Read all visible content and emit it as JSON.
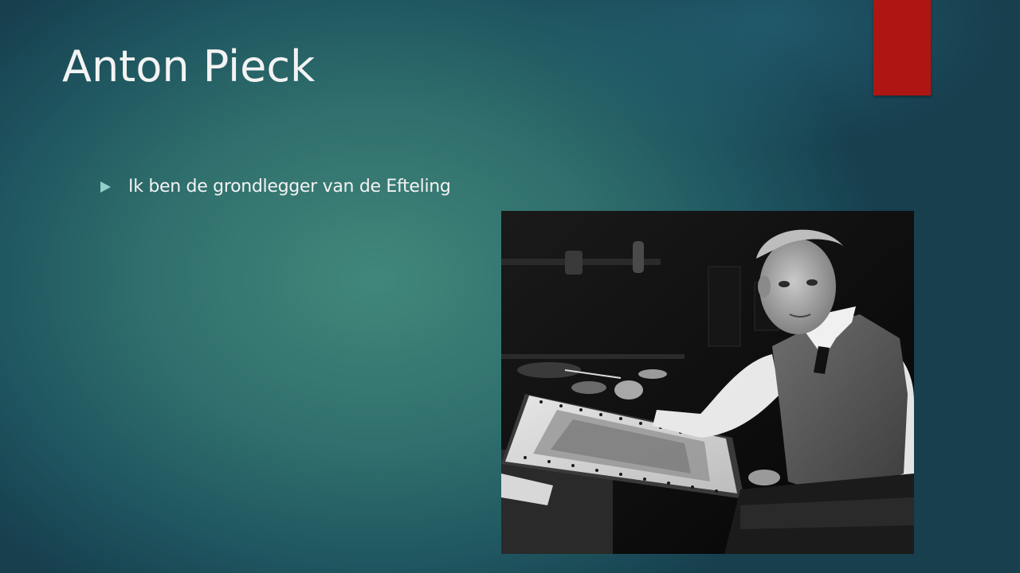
{
  "slide": {
    "title": "Anton Pieck",
    "bullets": [
      {
        "text": "Ik ben de grondlegger van de Efteling"
      }
    ]
  },
  "photo": {
    "alt": "Anton Pieck"
  },
  "colors": {
    "background": "#2f6f6d",
    "accent": "#ae1613",
    "bullet": "#8fd0c8",
    "text": "#f3f3f3"
  }
}
